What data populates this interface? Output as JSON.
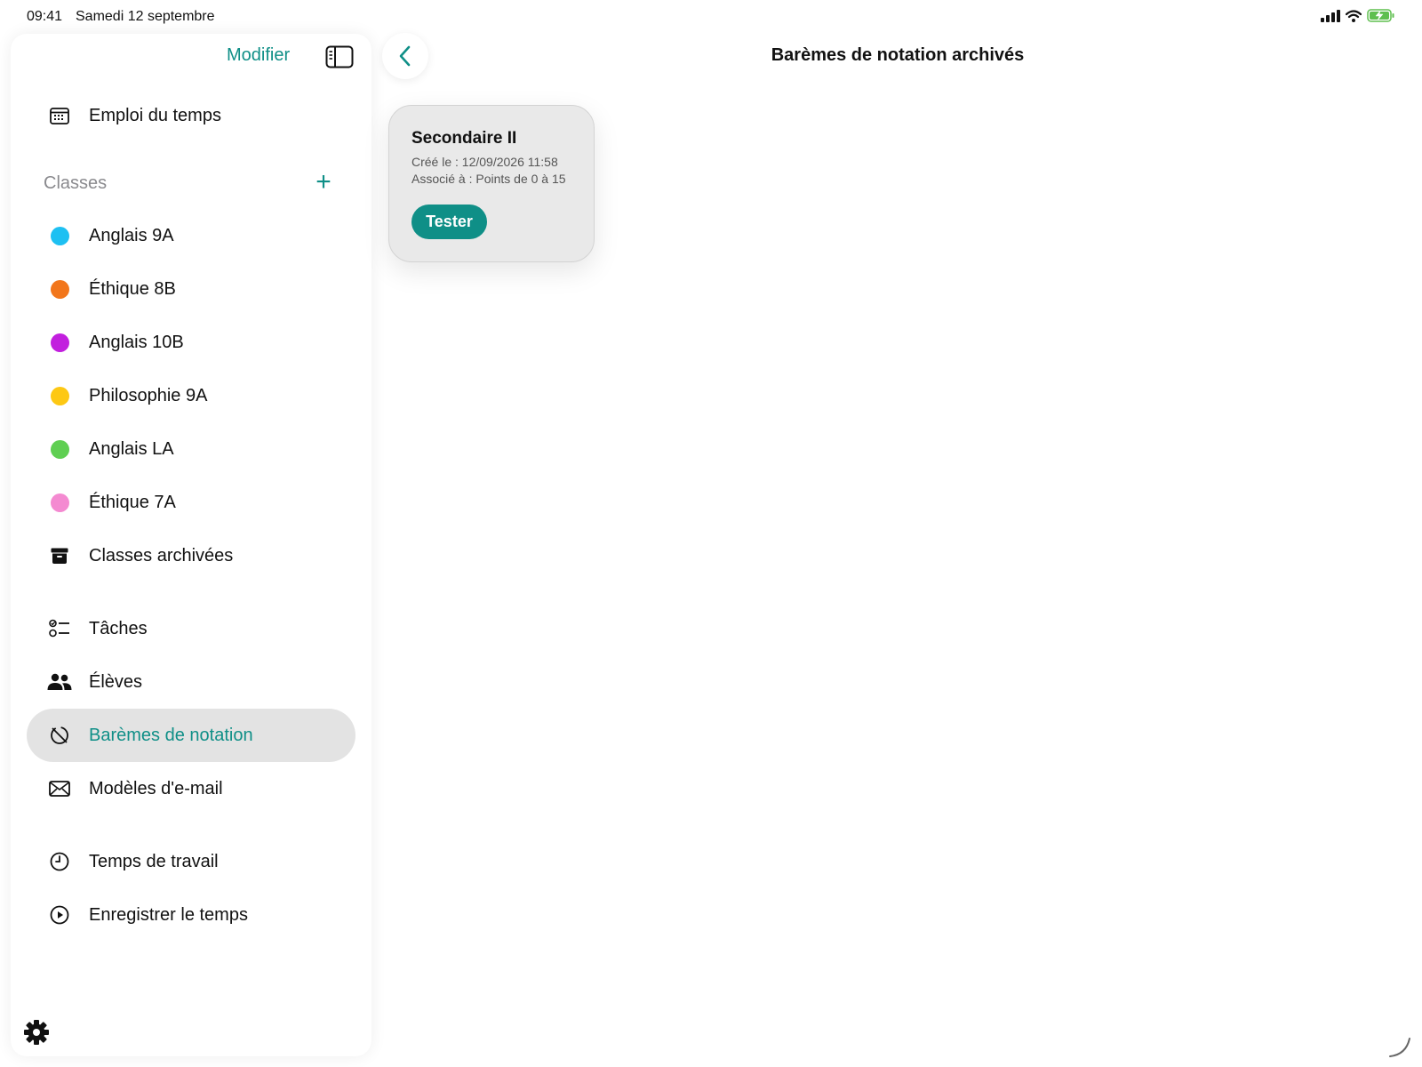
{
  "status_bar": {
    "time": "09:41",
    "date": "Samedi 12 septembre"
  },
  "sidebar": {
    "edit_label": "Modifier",
    "schedule_label": "Emploi du temps",
    "classes_header": "Classes",
    "classes": [
      {
        "label": "Anglais 9A",
        "color": "#1ec0f2"
      },
      {
        "label": "Éthique 8B",
        "color": "#f2761b"
      },
      {
        "label": "Anglais 10B",
        "color": "#c21fde"
      },
      {
        "label": "Philosophie 9A",
        "color": "#fdc814"
      },
      {
        "label": "Anglais LA",
        "color": "#5fcf52"
      },
      {
        "label": "Éthique 7A",
        "color": "#f48ad1"
      }
    ],
    "archived_classes_label": "Classes archivées",
    "tasks_label": "Tâches",
    "students_label": "Élèves",
    "grading_label": "Barèmes de notation",
    "email_templates_label": "Modèles d'e-mail",
    "work_time_label": "Temps de travail",
    "record_time_label": "Enregistrer le temps"
  },
  "main": {
    "title": "Barèmes de notation archivés",
    "card": {
      "title": "Secondaire II",
      "created": "Créé le : 12/09/2026 11:58",
      "associated": "Associé à : Points de 0 à 15",
      "button_label": "Tester"
    }
  },
  "colors": {
    "accent": "#0f8f87",
    "selected_bg": "#e3e3e3"
  }
}
